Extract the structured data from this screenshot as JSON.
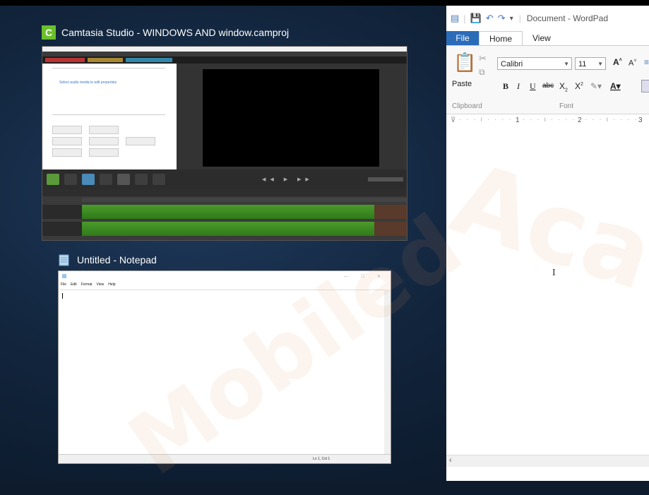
{
  "camtasia": {
    "label": "Camtasia Studio - WINDOWS AND window.camproj",
    "icon": "camtasia-icon",
    "icon_letter": "C",
    "accent": "#6bbf2a",
    "properties_label": "Select audio media to edit properties"
  },
  "notepad": {
    "label": "Untitled - Notepad",
    "icon": "notepad-icon",
    "menu": [
      "File",
      "Edit",
      "Format",
      "View",
      "Help"
    ],
    "status_position": "Ln 1, Col 1"
  },
  "wordpad": {
    "title": "Document - WordPad",
    "tabs": {
      "file": "File",
      "home": "Home",
      "view": "View"
    },
    "paste_label": "Paste",
    "font_name": "Calibri",
    "font_size": "11",
    "clipboard_group": "Clipboard",
    "font_group": "Font",
    "ruler_marks": [
      "1",
      "2",
      "3"
    ],
    "file_tab_color": "#2b6cb9"
  },
  "watermark": {
    "text_left": "Mobiled",
    "text_right": "Aca"
  }
}
